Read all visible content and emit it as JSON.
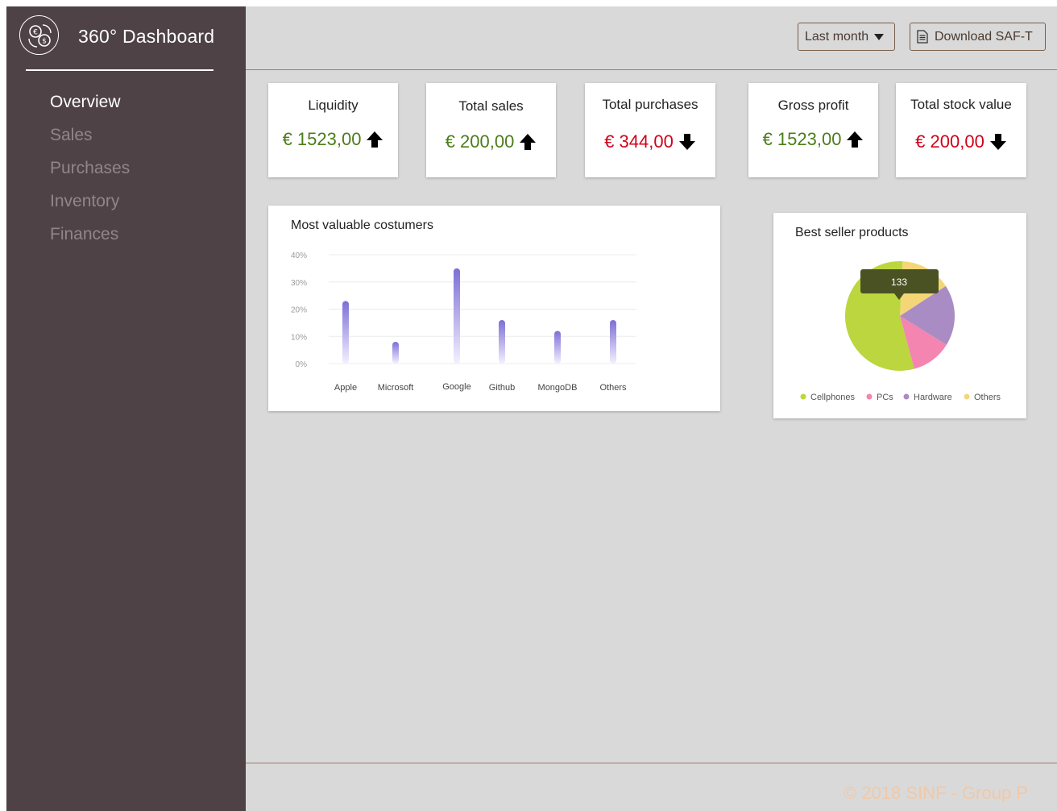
{
  "app": {
    "title": "360° Dashboard"
  },
  "sidebar": {
    "items": [
      {
        "label": "Overview",
        "active": true
      },
      {
        "label": "Sales",
        "active": false
      },
      {
        "label": "Purchases",
        "active": false
      },
      {
        "label": "Inventory",
        "active": false
      },
      {
        "label": "Finances",
        "active": false
      }
    ]
  },
  "header": {
    "period_label": "Last month",
    "download_label": "Download SAF-T",
    "period_icon": "caret-down-icon",
    "download_icon": "document-icon"
  },
  "kpis": [
    {
      "label": "Liquidity",
      "value": "€ 1523,00",
      "trend": "up"
    },
    {
      "label": "Total sales",
      "value": "€ 200,00",
      "trend": "up"
    },
    {
      "label": "Total purchases",
      "value": "€ 344,00",
      "trend": "down"
    },
    {
      "label": "Gross profit",
      "value": "€ 1523,00",
      "trend": "up"
    },
    {
      "label": "Total stock value",
      "value": "€ 200,00",
      "trend": "down"
    }
  ],
  "colors": {
    "sidebar": "#4e4247",
    "background": "#d9d9d9",
    "positive": "#4c7d1a",
    "negative": "#d0021b",
    "bar": "#7c6fd6",
    "footer_text": "#f2c8a5"
  },
  "chart_data": [
    {
      "type": "bar",
      "title": "Most valuable costumers",
      "categories": [
        "Apple",
        "Microsoft",
        "Google",
        "Github",
        "MongoDB",
        "Others"
      ],
      "values": [
        23,
        8,
        35,
        16,
        12,
        16
      ],
      "yticks": [
        "40%",
        "30%",
        "20%",
        "10%",
        "0%"
      ],
      "ylim": [
        0,
        40
      ],
      "grid": true
    },
    {
      "type": "pie",
      "title": "Best seller products",
      "labels": [
        "Cellphones",
        "PCs",
        "Hardware",
        "Others"
      ],
      "values": [
        55,
        12,
        18,
        15
      ],
      "colors": [
        "#bcd63f",
        "#f385b0",
        "#a98cc4",
        "#f5d676"
      ],
      "tooltip": "133",
      "legend_position": "bottom"
    }
  ],
  "footer": {
    "text": "© 2018 SINF - Group P"
  }
}
